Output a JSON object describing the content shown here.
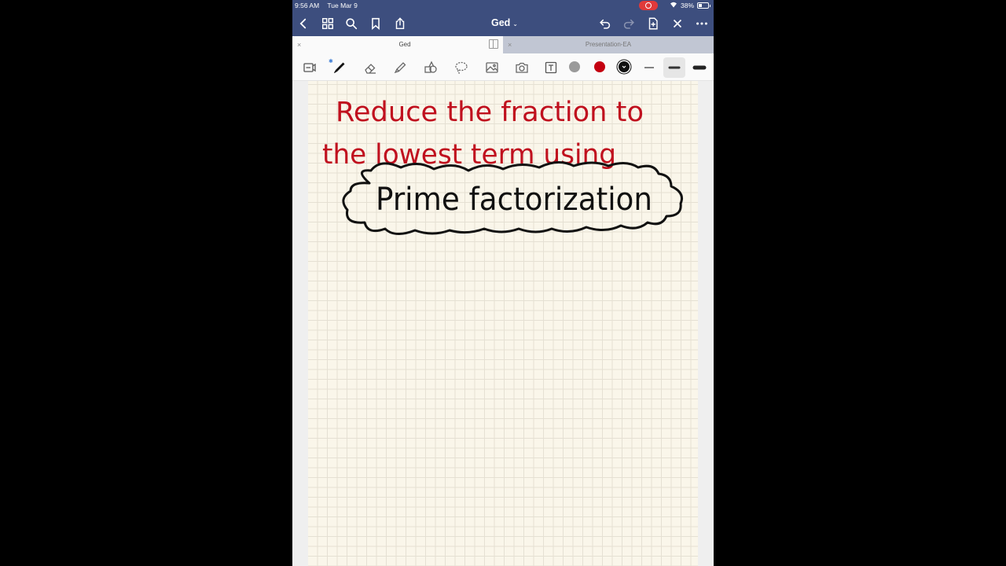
{
  "status_bar": {
    "time": "9:56 AM",
    "date": "Tue Mar 9",
    "battery": "38%"
  },
  "nav": {
    "title": "Ged"
  },
  "tabs": [
    {
      "label": "Ged"
    },
    {
      "label": "Presentation-EA"
    }
  ],
  "toolbar": {
    "tools": [
      "page-layout",
      "pen",
      "eraser",
      "highlighter",
      "shapes",
      "lasso",
      "image",
      "camera",
      "text"
    ],
    "colors": [
      "#9a9a9a",
      "#c40010",
      "#111111"
    ],
    "active_tool": "pen"
  },
  "note": {
    "line1": "Reduce the fraction to",
    "line2": "the lowest term using",
    "highlight": "Prime factorization",
    "ink_red": "#c0101e",
    "ink_black": "#111111"
  }
}
